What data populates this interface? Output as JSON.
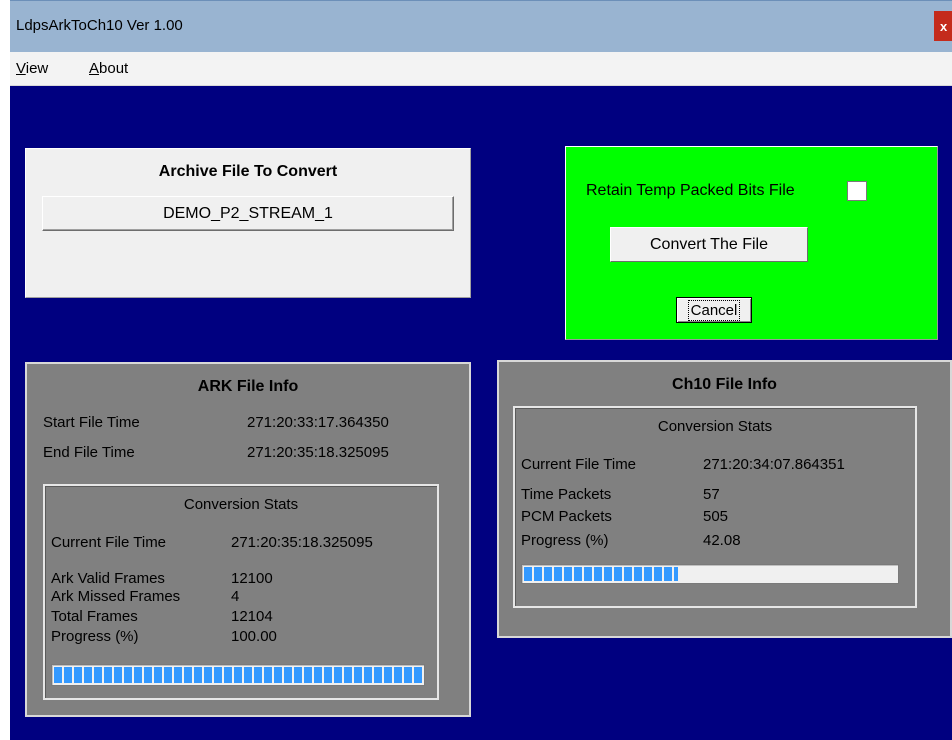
{
  "window": {
    "title": "LdpsArkToCh10 Ver 1.00",
    "close_label": "x"
  },
  "menu": {
    "items": [
      {
        "mnemonic": "V",
        "rest": "iew"
      },
      {
        "mnemonic": "A",
        "rest": "bout"
      }
    ]
  },
  "archive": {
    "heading": "Archive File To Convert",
    "file_name": "DEMO_P2_STREAM_1"
  },
  "options": {
    "retain_label": "Retain Temp Packed Bits File",
    "retain_checked": false,
    "convert_label": "Convert The File",
    "cancel_label": "Cancel"
  },
  "ark": {
    "heading": "ARK File Info",
    "start_label": "Start File Time",
    "start_value": "271:20:33:17.364350",
    "end_label": "End File Time",
    "end_value": "271:20:35:18.325095",
    "stats": {
      "title": "Conversion Stats",
      "current_label": "Current File Time",
      "current_value": "271:20:35:18.325095",
      "valid_label": "Ark Valid Frames",
      "valid_value": "12100",
      "missed_label": "Ark Missed Frames",
      "missed_value": "4",
      "total_label": "Total Frames",
      "total_value": "12104",
      "progress_label": "Progress (%)",
      "progress_value": "100.00",
      "progress_percent": 100
    }
  },
  "ch10": {
    "heading": "Ch10 File Info",
    "stats": {
      "title": "Conversion Stats",
      "current_label": "Current File Time",
      "current_value": "271:20:34:07.864351",
      "time_packets_label": "Time Packets",
      "time_packets_value": "57",
      "pcm_packets_label": "PCM Packets",
      "pcm_packets_value": "505",
      "progress_label": "Progress (%)",
      "progress_value": "42.08",
      "progress_percent": 42.08
    }
  },
  "colors": {
    "titlebar": "#99b4d1",
    "client_background": "#000080",
    "options_panel": "#00ff00",
    "info_panel": "#808080",
    "progress_fill": "#3399ff"
  }
}
